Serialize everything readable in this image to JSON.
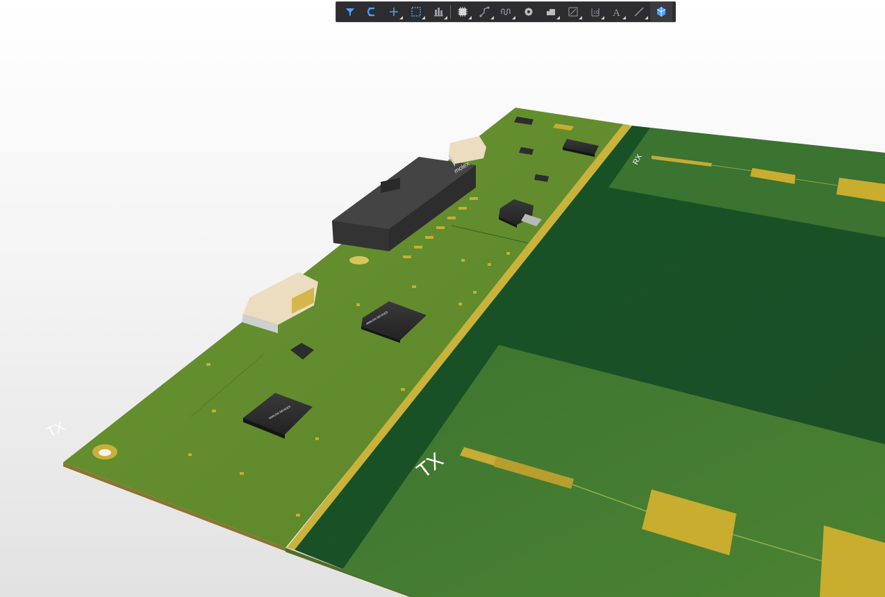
{
  "board": {
    "silk_tx_left": "TX",
    "silk_tx_main": "TX",
    "silk_rx": "RX",
    "chip_mark_1": "ANALOG DEVICES",
    "chip_mark_2": "ANALOG DEVICES",
    "connector_mark": "molex"
  },
  "toolbar": {
    "buttons": [
      {
        "name": "filter-icon"
      },
      {
        "name": "snap-magnet-icon"
      },
      {
        "name": "add-cross-icon"
      },
      {
        "name": "select-rect-icon"
      },
      {
        "name": "align-bars-icon"
      },
      {
        "name": "component-chip-icon"
      },
      {
        "name": "route-track-icon"
      },
      {
        "name": "interactive-length-icon"
      },
      {
        "name": "via-pad-icon"
      },
      {
        "name": "polygon-fill-icon"
      },
      {
        "name": "dimension-icon"
      },
      {
        "name": "designator-string-icon"
      },
      {
        "name": "text-a-icon"
      },
      {
        "name": "line-icon"
      },
      {
        "name": "3d-body-icon"
      }
    ],
    "colors": {
      "bar_bg": "#2d2d30",
      "icon_active": "#4aa3ff",
      "icon_idle": "#9a9aa0"
    }
  },
  "colors": {
    "pcb_green": "#5f8a2c",
    "pcb_dark": "#1e5229",
    "copper": "#c8ae32",
    "board_edge": "#7a6a2a",
    "chip_black": "#2a2a2a",
    "connector_beige": "#ecdcc0"
  }
}
